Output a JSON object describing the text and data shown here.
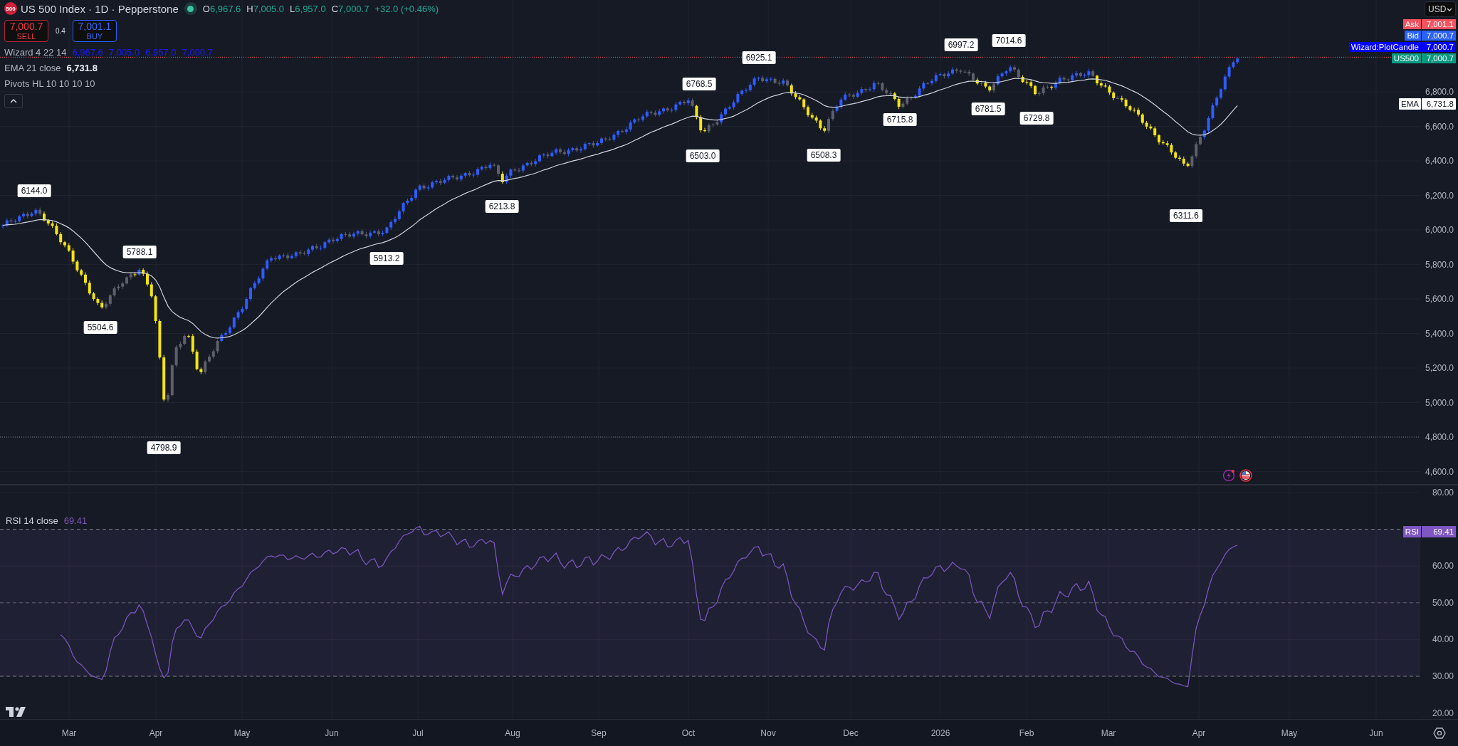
{
  "symbol": {
    "logo_text": "500",
    "title": "US 500 Index · 1D · Pepperstone",
    "ohlc": [
      {
        "key": "O",
        "value": "6,967.6"
      },
      {
        "key": "H",
        "value": "7,005.0"
      },
      {
        "key": "L",
        "value": "6,957.0"
      },
      {
        "key": "C",
        "value": "7,000.7"
      }
    ],
    "change": "+32.0 (+0.46%)"
  },
  "trade": {
    "sell_price": "7,000.7",
    "sell_label": "SELL",
    "spread": "0.4",
    "buy_price": "7,001.1",
    "buy_label": "BUY"
  },
  "indicators": [
    {
      "kind": "wizard",
      "name": "Wizard 4 22 14",
      "values": [
        "6,967.6",
        "7,005.0",
        "6,957.0",
        "7,000.7"
      ]
    },
    {
      "kind": "ema",
      "name": "EMA 21 close",
      "values": [
        "6,731.8"
      ]
    },
    {
      "kind": "pivots",
      "name": "Pivots HL 10 10 10 10"
    }
  ],
  "currency": "USD",
  "price_tags": [
    {
      "label": "Ask",
      "value": "7,001.1",
      "color": "#f7525f"
    },
    {
      "label": "Bid",
      "value": "7,000.7",
      "color": "#2962ff"
    },
    {
      "label": "Wizard:PlotCandle",
      "value": "7,000.7",
      "color": "#0000ff"
    },
    {
      "label": "US500",
      "value": "7,000.7",
      "color": "#089981"
    }
  ],
  "ema_tag": {
    "label": "EMA",
    "value": "6,731.8"
  },
  "price_axis": [
    "6,800.0",
    "6,600.0",
    "6,400.0",
    "6,200.0",
    "6,000.0",
    "5,800.0",
    "5,600.0",
    "5,400.0",
    "5,200.0",
    "5,000.0",
    "4,800.0",
    "4,600.0"
  ],
  "pivots": [
    {
      "label": "6144.0",
      "kind": "high"
    },
    {
      "label": "5504.6",
      "kind": "low"
    },
    {
      "label": "5788.1",
      "kind": "high"
    },
    {
      "label": "4798.9",
      "kind": "low"
    },
    {
      "label": "5913.2",
      "kind": "low"
    },
    {
      "label": "6213.8",
      "kind": "low"
    },
    {
      "label": "6768.5",
      "kind": "high"
    },
    {
      "label": "6503.0",
      "kind": "low"
    },
    {
      "label": "6925.1",
      "kind": "high"
    },
    {
      "label": "6508.3",
      "kind": "low"
    },
    {
      "label": "6715.8",
      "kind": "low"
    },
    {
      "label": "6997.2",
      "kind": "high"
    },
    {
      "label": "6781.5",
      "kind": "low"
    },
    {
      "label": "7014.6",
      "kind": "high"
    },
    {
      "label": "6729.8",
      "kind": "low"
    },
    {
      "label": "6311.6",
      "kind": "low"
    }
  ],
  "rsi": {
    "title": "RSI 14 close",
    "value": "69.41",
    "tag_label": "RSI",
    "tag_value": "69.41",
    "axis": [
      "80.00",
      "60.00",
      "50.00",
      "40.00",
      "30.00",
      "20.00"
    ]
  },
  "time_axis": [
    "Mar",
    "Apr",
    "May",
    "Jun",
    "Jul",
    "Aug",
    "Sep",
    "Oct",
    "Nov",
    "Dec",
    "2026",
    "Feb",
    "Mar",
    "Apr",
    "May",
    "Jun"
  ]
}
